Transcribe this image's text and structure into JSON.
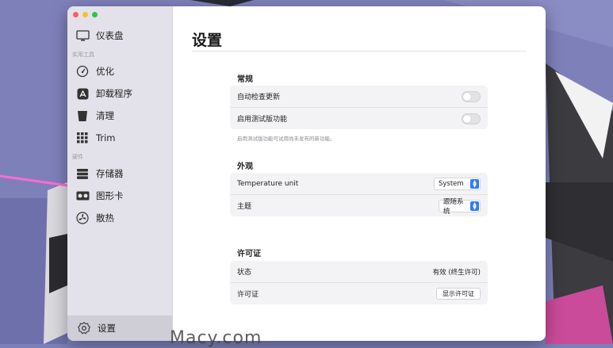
{
  "sidebar": {
    "top_item": {
      "label": "仪表盘",
      "icon": "monitor-icon"
    },
    "sections": [
      {
        "title": "实用工具"
      },
      {
        "title": "硬件"
      }
    ],
    "tools": [
      {
        "label": "优化",
        "icon": "gauge-icon"
      },
      {
        "label": "卸载程序",
        "icon": "app-store-icon"
      },
      {
        "label": "清理",
        "icon": "trash-icon"
      },
      {
        "label": "Trim",
        "icon": "grid-icon"
      }
    ],
    "hardware": [
      {
        "label": "存储器",
        "icon": "drive-icon"
      },
      {
        "label": "图形卡",
        "icon": "gpu-icon"
      },
      {
        "label": "散热",
        "icon": "fan-icon"
      }
    ],
    "bottom_item": {
      "label": "设置",
      "icon": "gear-icon"
    }
  },
  "main": {
    "title": "设置",
    "general": {
      "title": "常规",
      "auto_update": "自动检查更新",
      "beta": "启用测试版功能",
      "beta_note": "启用测试版功能可试用尚未发布的新功能。"
    },
    "appearance": {
      "title": "外观",
      "temp_label": "Temperature unit",
      "temp_value": "System",
      "theme_label": "主题",
      "theme_value": "跟随系统"
    },
    "license": {
      "title": "许可证",
      "status_label": "状态",
      "status_value": "有效 (终生许可)",
      "license_label": "许可证",
      "show_button": "显示许可证"
    }
  },
  "watermark": "Macy.com",
  "colors": {
    "accent": "#2f7cf6",
    "sidebar_bg": "#e3e2ea",
    "wallpaper": "#7d7fb8"
  }
}
